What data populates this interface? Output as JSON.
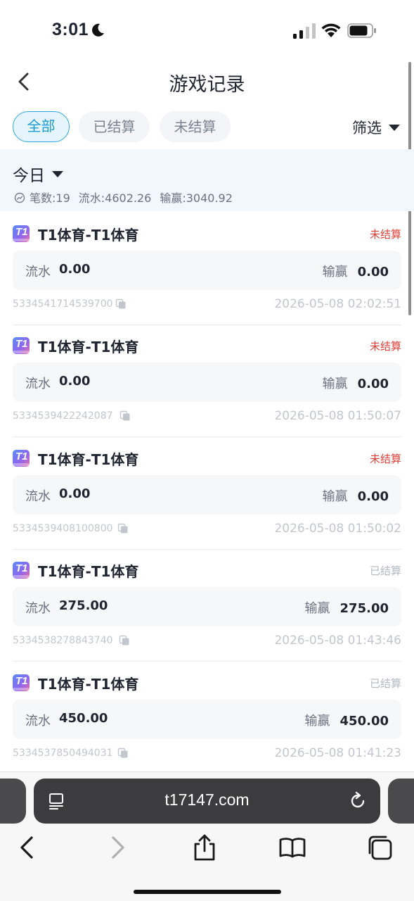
{
  "status_bar": {
    "time": "3:01"
  },
  "header": {
    "title": "游戏记录"
  },
  "tabs": [
    {
      "label": "全部",
      "active": true
    },
    {
      "label": "已结算",
      "active": false
    },
    {
      "label": "未结算",
      "active": false
    }
  ],
  "filter_label": "筛选",
  "summary": {
    "date": "今日",
    "count": "笔数:19",
    "turnover": "流水:4602.26",
    "winloss": "输赢:3040.92"
  },
  "labels": {
    "turnover": "流水",
    "winloss": "输赢"
  },
  "records": [
    {
      "name": "T1体育-T1体育",
      "status": "未结算",
      "status_type": "unsettled",
      "turnover": "0.00",
      "winloss": "0.00",
      "id": "5334541714539700",
      "time": "2026-05-08 02:02:51"
    },
    {
      "name": "T1体育-T1体育",
      "status": "未结算",
      "status_type": "unsettled",
      "turnover": "0.00",
      "winloss": "0.00",
      "id": "5334539422242087",
      "time": "2026-05-08 01:50:07"
    },
    {
      "name": "T1体育-T1体育",
      "status": "未结算",
      "status_type": "unsettled",
      "turnover": "0.00",
      "winloss": "0.00",
      "id": "5334539408100800",
      "time": "2026-05-08 01:50:02"
    },
    {
      "name": "T1体育-T1体育",
      "status": "已结算",
      "status_type": "settled",
      "turnover": "275.00",
      "winloss": "275.00",
      "id": "5334538278843740",
      "time": "2026-05-08 01:43:46"
    },
    {
      "name": "T1体育-T1体育",
      "status": "已结算",
      "status_type": "settled",
      "turnover": "450.00",
      "winloss": "450.00",
      "id": "5334537850494031",
      "time": "2026-05-08 01:41:23"
    }
  ],
  "logo_text": "T1",
  "browser": {
    "url": "t17147.com"
  },
  "colors": {
    "accent": "#1c9bd6",
    "unsettled": "#e0413a",
    "settled": "#b3b8c2"
  },
  "icons": [
    "moon-icon",
    "signal-icon",
    "wifi-icon",
    "battery-icon",
    "back-icon",
    "chevron-down-icon",
    "trend-icon",
    "copy-icon",
    "page-menu-icon",
    "reload-icon",
    "browser-back-icon",
    "browser-forward-icon",
    "share-icon",
    "bookmarks-icon",
    "tabs-icon"
  ]
}
